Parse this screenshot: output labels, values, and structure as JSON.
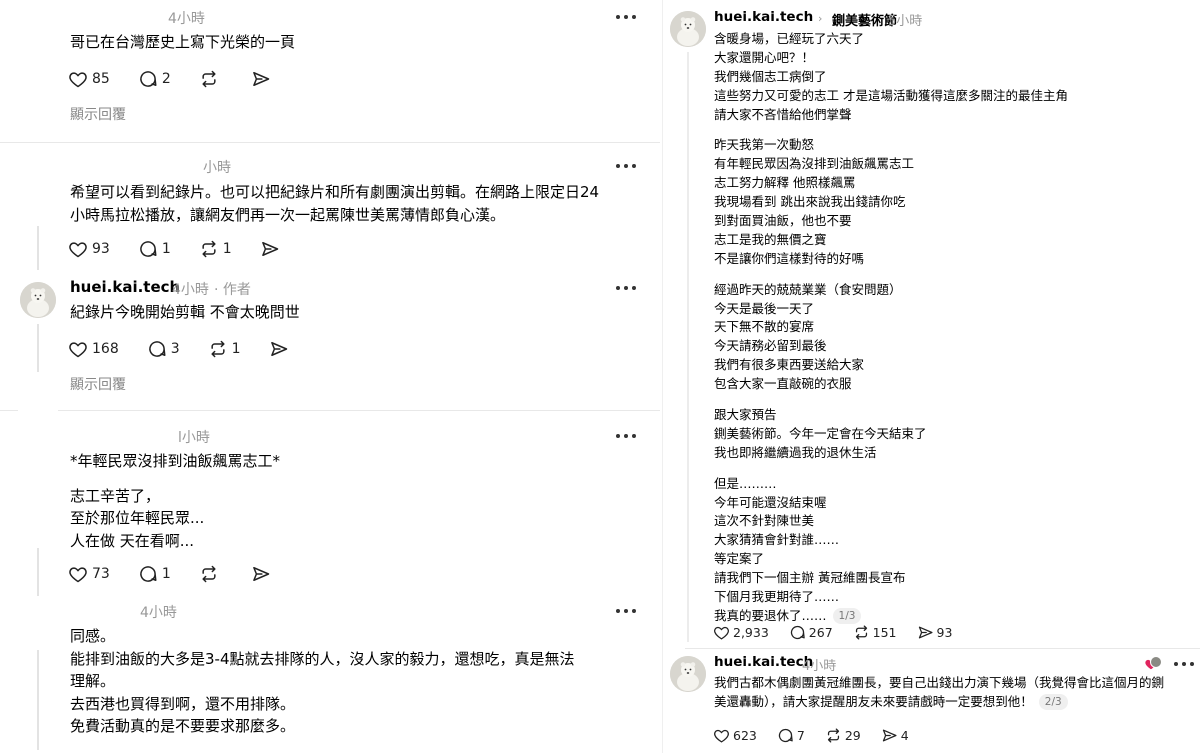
{
  "icons": {
    "like": "heart-icon",
    "comment": "comment-icon",
    "repost": "repost-icon",
    "share": "send-icon",
    "more": "more-icon"
  },
  "colors": {
    "muted": "#999999",
    "divider": "#e8e8e8",
    "accent_red": "#e0245e"
  },
  "left": {
    "reply_label": "顯示回覆",
    "comments": [
      {
        "time": "4小時",
        "lines": [
          "哥已在台灣歷史上寫下光榮的一頁"
        ],
        "likes": "85",
        "comments": "2",
        "reposts": "",
        "show_replies": true
      },
      {
        "time": "小時",
        "lines": [
          "希望可以看到紀錄片。也可以把紀錄片和所有劇團演出剪輯。在網路上限定日24",
          "小時馬拉松播放，讓網友們再一次一起罵陳世美罵薄情郎負心漢。"
        ],
        "likes": "93",
        "comments": "1",
        "reposts": "1"
      },
      {
        "username": "huei.kai.tech",
        "time": "4小時",
        "role": "· 作者",
        "lines": [
          "紀錄片今晚開始剪輯 不會太晚問世"
        ],
        "likes": "168",
        "comments": "3",
        "reposts": "1",
        "show_replies": true
      },
      {
        "time": "l小時",
        "lines": [
          "*年輕民眾沒排到油飯飆罵志工*",
          "志工辛苦了，",
          "至於那位年輕民眾...",
          "人在做 天在看啊..."
        ],
        "likes": "73",
        "comments": "1",
        "reposts": ""
      },
      {
        "time": "4小時",
        "lines": [
          "同感。",
          "能排到油飯的大多是3-4點就去排隊的人，沒人家的毅力，還想吃，真是無法",
          "理解。",
          "去西港也買得到啊，還不用排隊。",
          "免費活動真的是不要要求那麼多。"
        ]
      }
    ]
  },
  "right": {
    "post": {
      "username": "huei.kai.tech",
      "breadcrumb": "鍘美藝術節",
      "time": "5小時",
      "paragraphs": [
        [
          "含暖身場，已經玩了六天了",
          "大家還開心吧？！",
          "我們幾個志工病倒了",
          "這些努力又可愛的志工 才是這場活動獲得這麼多關注的最佳主角",
          "請大家不吝惜給他們掌聲"
        ],
        [
          "昨天我第一次動怒",
          "有年輕民眾因為沒排到油飯飆罵志工",
          "志工努力解釋 他照樣飆罵",
          "我現場看到 跳出來說我出錢請你吃",
          "到對面買油飯，他也不要",
          "志工是我的無價之寶",
          "不是讓你們這樣對待的好嗎"
        ],
        [
          "經過昨天的兢兢業業（食安問題）",
          "今天是最後一天了",
          "天下無不散的宴席",
          "今天請務必留到最後",
          "我們有很多東西要送給大家",
          "包含大家一直敲碗的衣服"
        ],
        [
          "跟大家預告",
          "鍘美藝術節。今年一定會在今天結束了",
          "我也即將繼續過我的退休生活"
        ],
        [
          "但是………",
          "今年可能還沒結束喔",
          "這次不針對陳世美",
          "大家猜猜會針對誰……",
          "等定案了",
          "請我們下一個主辦 黃冠維團長宣布",
          "下個月我更期待了……",
          "我真的要退休了……"
        ]
      ],
      "page_indicator": "1/3",
      "likes": "2,933",
      "comments": "267",
      "reposts": "151",
      "shares": "93"
    },
    "reply": {
      "username": "huei.kai.tech",
      "time": "4小時",
      "lines": [
        "我們古都木偶劇團黃冠維團長，要自己出錢出力演下幾場（我覺得會比這個月的鍘",
        "美還轟動），請大家提醒朋友未來要請戲時一定要想到他！"
      ],
      "page_indicator": "2/3",
      "likes": "623",
      "comments": "7",
      "reposts": "29",
      "shares": "4"
    }
  }
}
